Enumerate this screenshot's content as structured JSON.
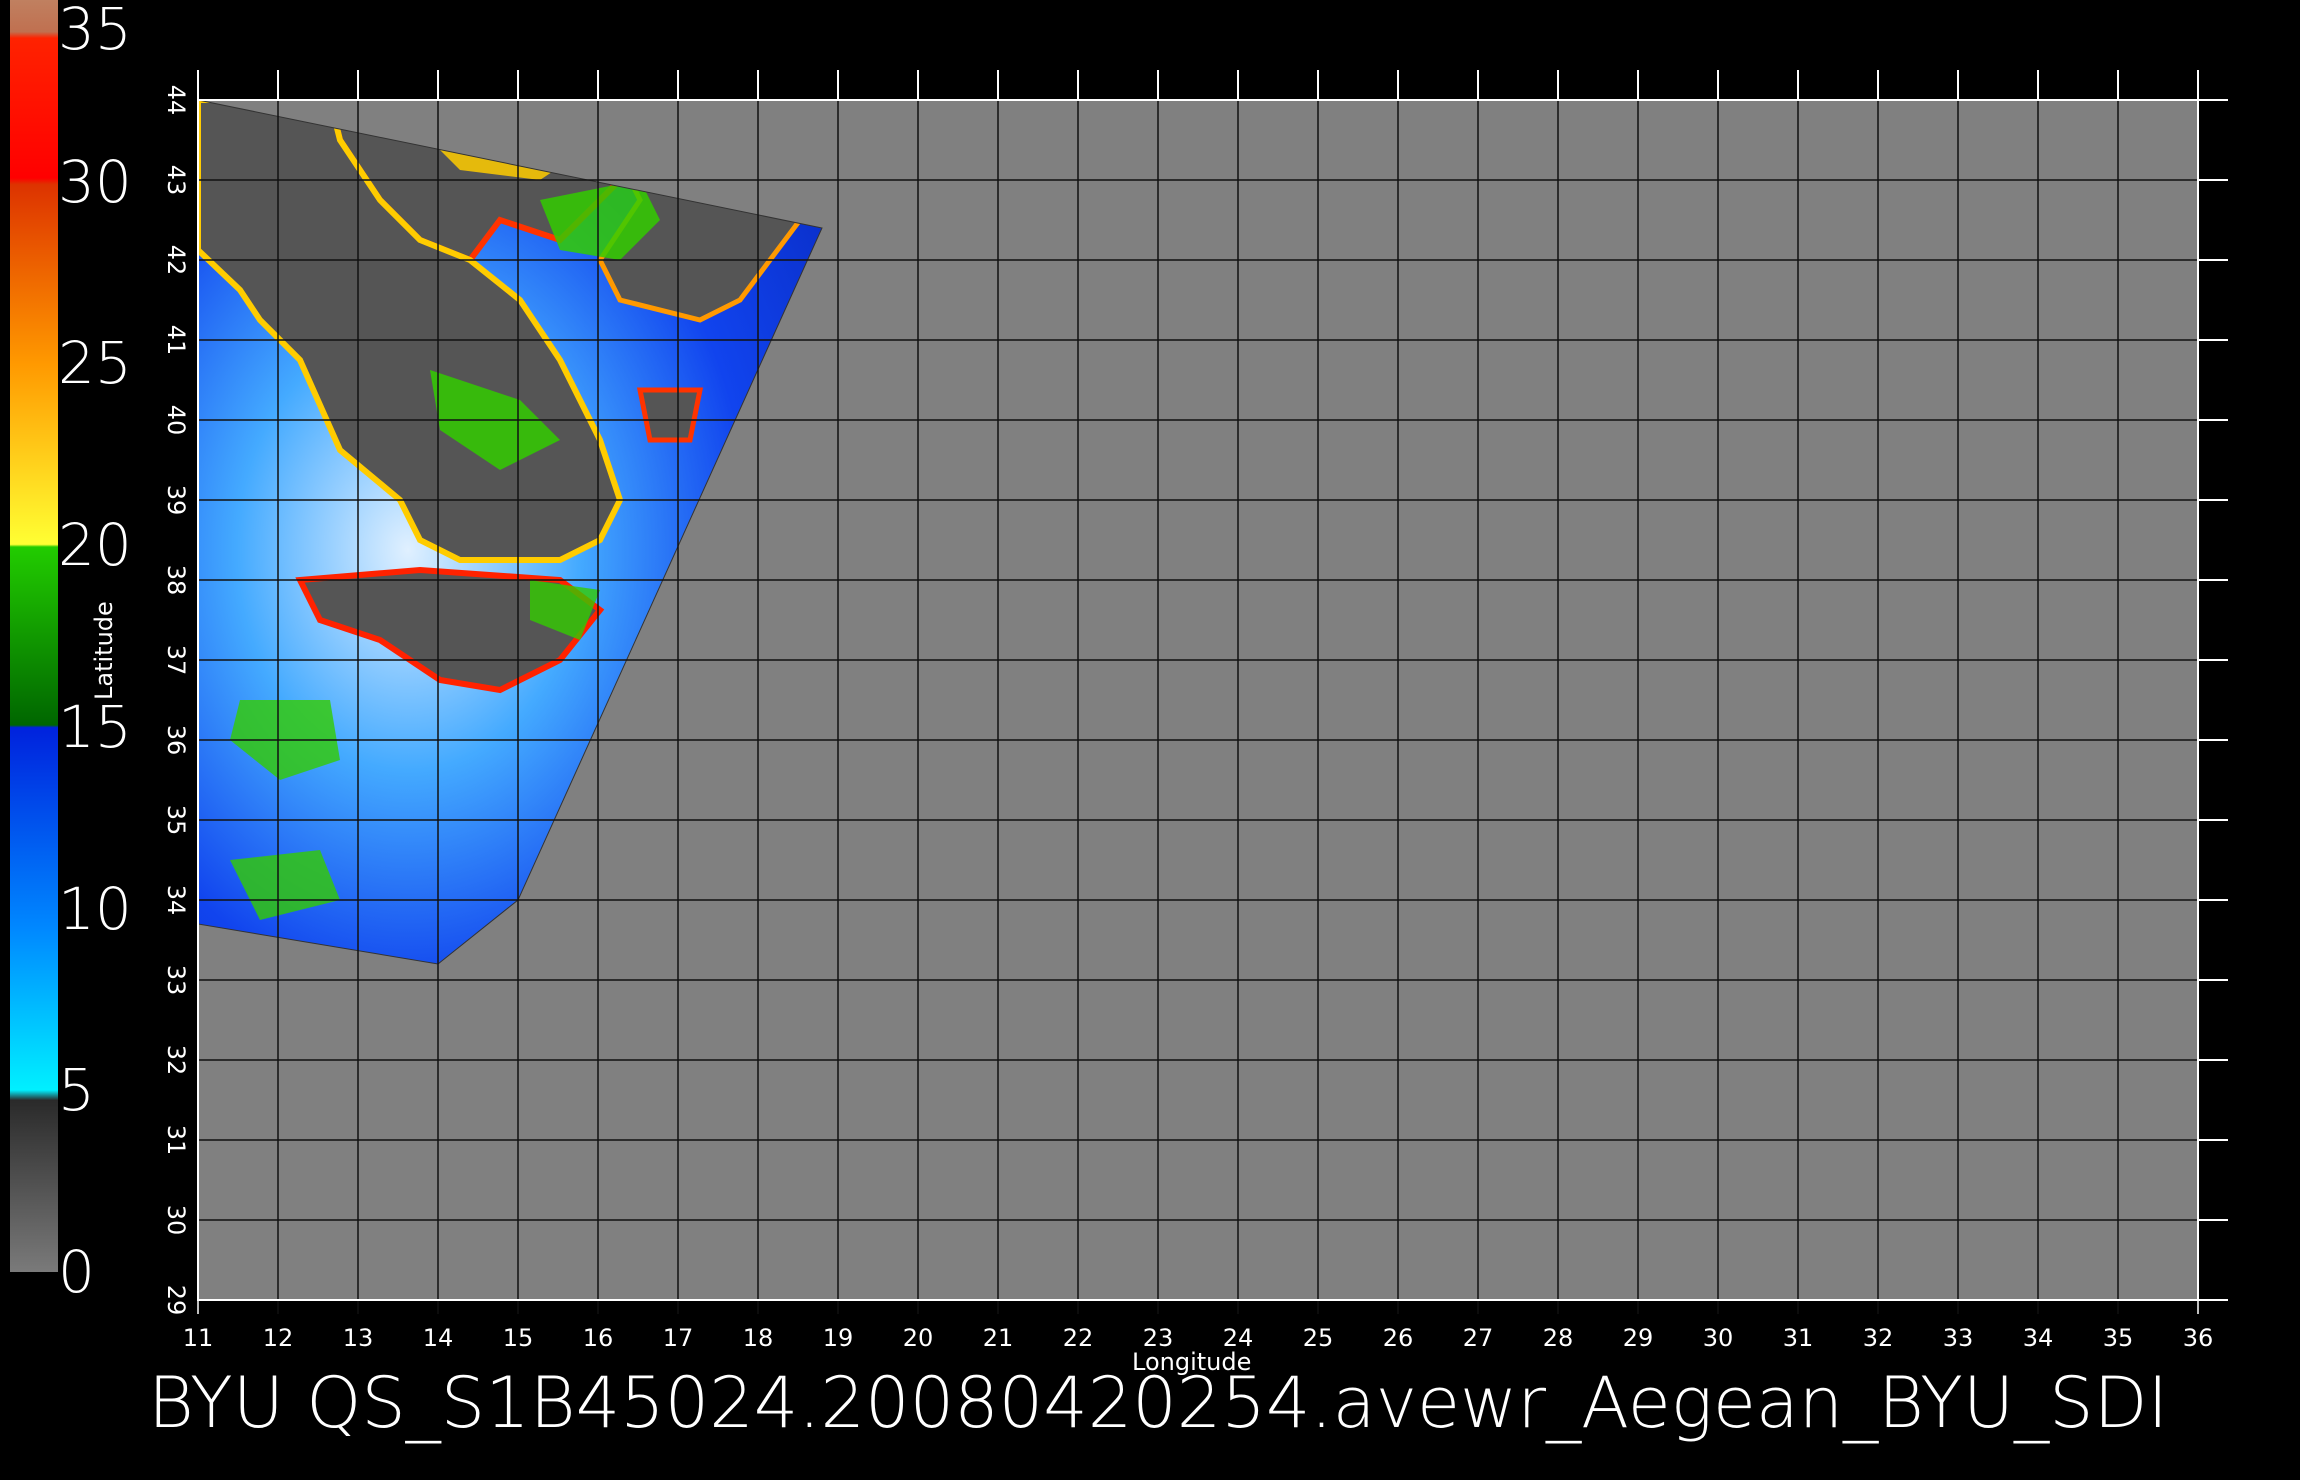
{
  "title": "BYU  QS_S1B45024.20080420254.avewr_Aegean_BYU_SDI",
  "chart_data": {
    "type": "heatmap",
    "xlabel": "Longitude",
    "ylabel": "Latitude",
    "xlim": [
      11,
      36
    ],
    "ylim": [
      29,
      44
    ],
    "xticks": [
      "11",
      "12",
      "13",
      "14",
      "15",
      "16",
      "17",
      "18",
      "19",
      "20",
      "21",
      "22",
      "23",
      "24",
      "25",
      "26",
      "27",
      "28",
      "29",
      "30",
      "31",
      "32",
      "33",
      "34",
      "35",
      "36"
    ],
    "yticks": [
      "29",
      "30",
      "31",
      "32",
      "33",
      "34",
      "35",
      "36",
      "37",
      "38",
      "39",
      "40",
      "41",
      "42",
      "43",
      "44"
    ],
    "grid": true,
    "colorbar": {
      "labels": [
        "35",
        "30",
        "25",
        "20",
        "15",
        "10",
        "5",
        "0"
      ],
      "range": [
        0,
        35
      ]
    },
    "background_color": "#808080",
    "land_color": "#555555",
    "swath_polygon": [
      [
        11,
        44
      ],
      [
        18.8,
        42.4
      ],
      [
        15,
        34
      ],
      [
        14,
        33.2
      ],
      [
        11,
        33.7
      ]
    ]
  }
}
